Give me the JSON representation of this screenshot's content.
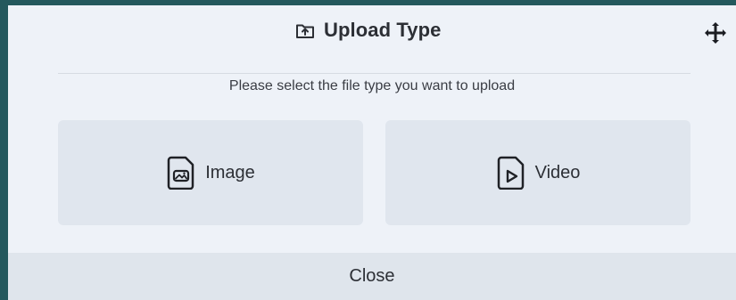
{
  "dialog": {
    "title": "Upload Type",
    "subtitle": "Please select the file type you want to upload",
    "icons": {
      "title": "upload-folder-icon",
      "move": "move-icon",
      "image": "image-file-icon",
      "video": "video-file-icon"
    },
    "choices": {
      "image_label": "Image",
      "video_label": "Video"
    },
    "footer": {
      "close_label": "Close"
    },
    "colors": {
      "background": "#eef2f8",
      "choice_bg": "#e0e6ee",
      "footer_bg": "#dfe5ec",
      "text": "#2c2f35",
      "frame": "#24585d"
    }
  }
}
